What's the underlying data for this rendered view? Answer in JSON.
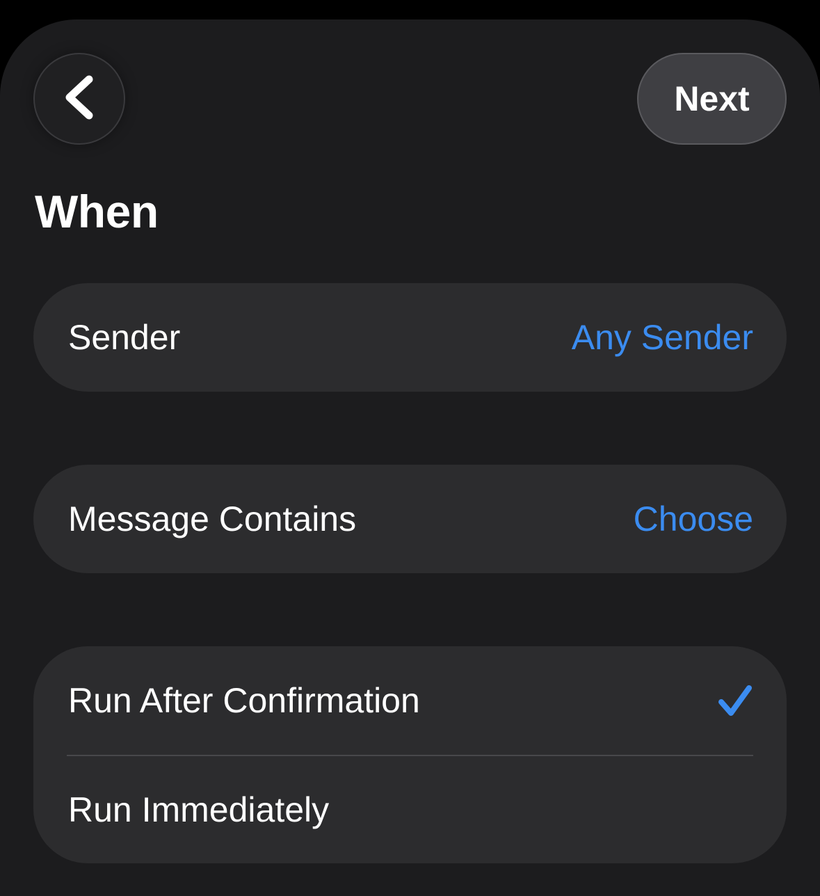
{
  "header": {
    "back_icon": "chevron-left-icon",
    "next_label": "Next"
  },
  "section": {
    "title": "When"
  },
  "rows": {
    "sender": {
      "label": "Sender",
      "value": "Any Sender"
    },
    "message_contains": {
      "label": "Message Contains",
      "value": "Choose"
    }
  },
  "run_options": [
    {
      "label": "Run After Confirmation",
      "selected": true
    },
    {
      "label": "Run Immediately",
      "selected": false
    }
  ],
  "colors": {
    "background": "#1c1c1e",
    "card": "#2c2c2e",
    "accent": "#3b8cf0",
    "text": "#ffffff"
  }
}
